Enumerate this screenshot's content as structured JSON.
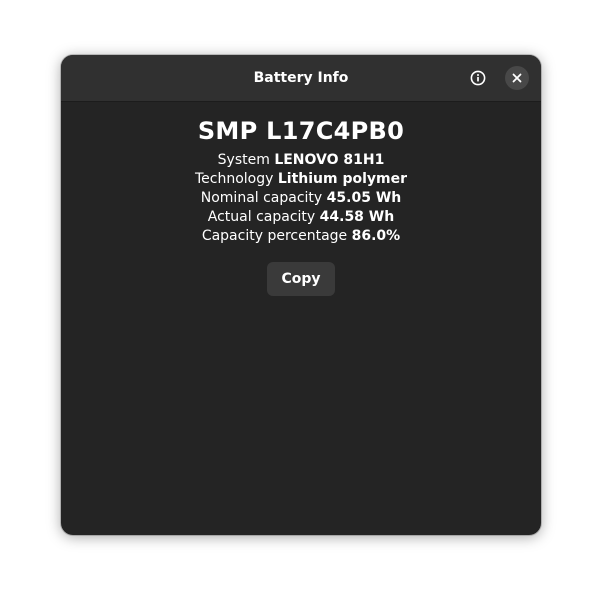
{
  "window": {
    "title": "Battery Info",
    "info_icon": "info-icon",
    "close_icon": "close-icon"
  },
  "device": {
    "name": "SMP L17C4PB0"
  },
  "properties": [
    {
      "label": "System",
      "value": "LENOVO 81H1"
    },
    {
      "label": "Technology",
      "value": "Lithium polymer"
    },
    {
      "label": "Nominal capacity",
      "value": "45.05 Wh"
    },
    {
      "label": "Actual capacity",
      "value": "44.58 Wh"
    },
    {
      "label": "Capacity percentage",
      "value": "86.0%"
    }
  ],
  "actions": {
    "copy_label": "Copy"
  },
  "colors": {
    "window_bg": "#242424",
    "headerbar_bg": "#303030",
    "button_bg": "#3a3a3a",
    "text": "#ffffff"
  }
}
